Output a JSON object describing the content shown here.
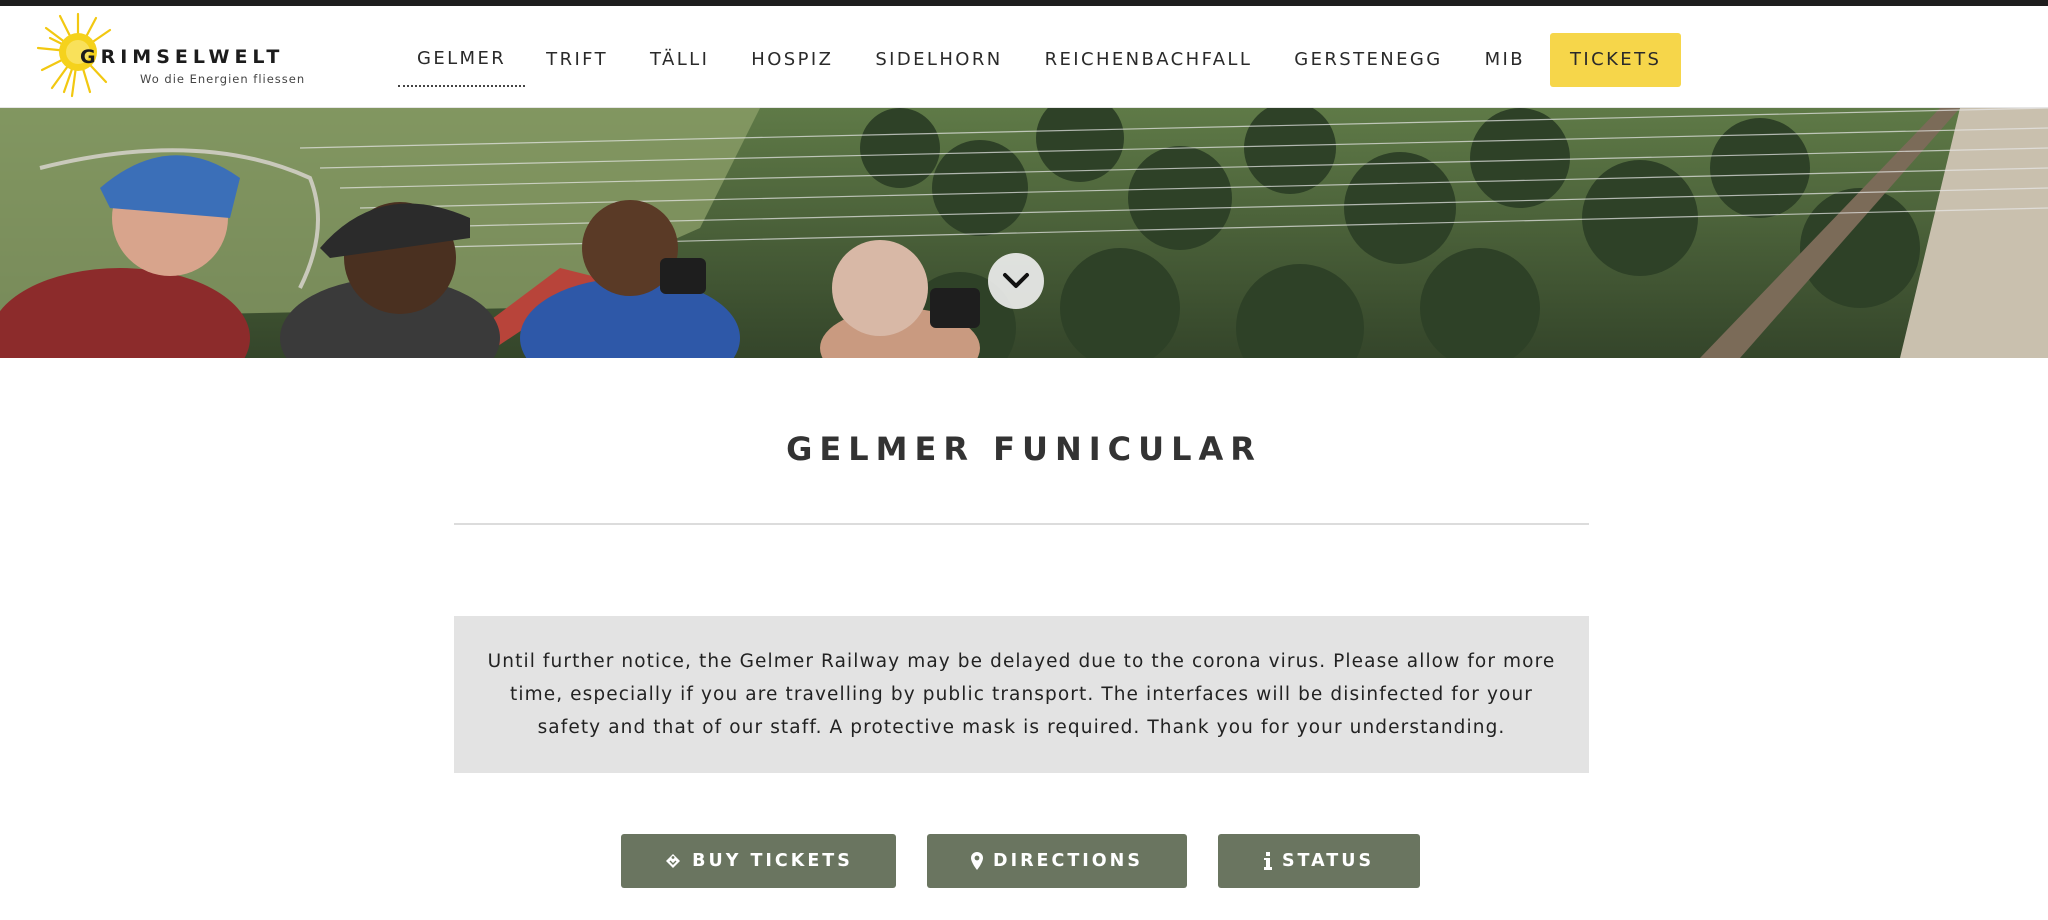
{
  "brand": {
    "name": "GRIMSELWELT",
    "tagline": "Wo die Energien fliessen",
    "accent_color": "#f6d64a"
  },
  "nav": {
    "items": [
      {
        "label": "GELMER",
        "active": true
      },
      {
        "label": "TRIFT"
      },
      {
        "label": "TÄLLI"
      },
      {
        "label": "HOSPIZ"
      },
      {
        "label": "SIDELHORN"
      },
      {
        "label": "REICHENBACHFALL"
      },
      {
        "label": "GERSTENEGG"
      },
      {
        "label": "MIB"
      }
    ],
    "tickets_label": "TICKETS"
  },
  "hero": {
    "scroll_icon": "chevron-down-icon"
  },
  "page": {
    "title": "GELMER FUNICULAR",
    "notice": "Until further notice, the Gelmer Railway may be delayed due to the corona virus. Please allow for more time, especially if you are travelling by public transport. The interfaces will be disinfected for your safety and that of our staff. A protective mask is required. Thank you for your understanding."
  },
  "actions": {
    "buy_tickets": {
      "label": "BUY TICKETS",
      "icon": "ticket-icon"
    },
    "directions": {
      "label": "DIRECTIONS",
      "icon": "map-marker-icon"
    },
    "status": {
      "label": "STATUS",
      "icon": "info-icon"
    },
    "button_color": "#6a7560"
  }
}
